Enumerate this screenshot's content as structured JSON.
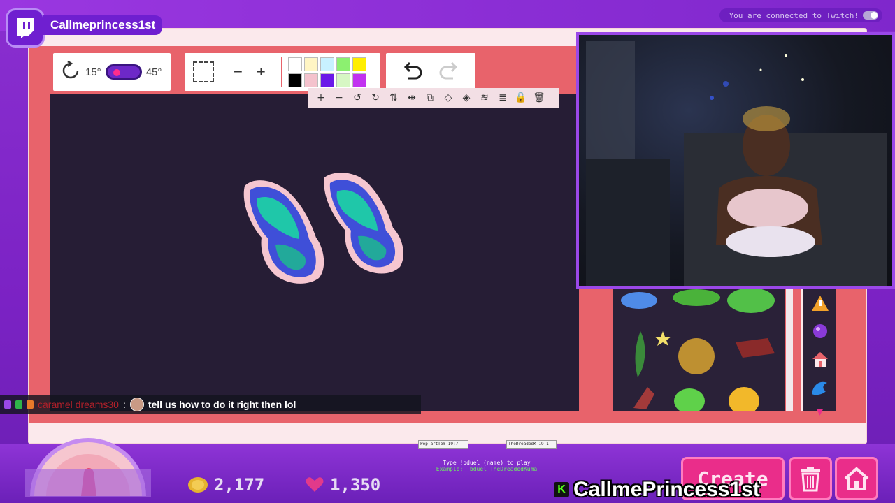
{
  "overlay": {
    "channel_name": "Callmeprincess1st",
    "connection_status": "You are connected to Twitch!"
  },
  "toolbar": {
    "rotate_min": "15°",
    "rotate_max": "45°",
    "zoom_out": "−",
    "zoom_in": "+",
    "palette": [
      "#ffffff",
      "#fff5c4",
      "#c8f1ff",
      "#8cf070",
      "#ffee00",
      "#000000",
      "#f4c2cd",
      "#6b18e8",
      "#d7f7c4",
      "#c232f0"
    ]
  },
  "layer_toolbar": {
    "buttons": [
      "+",
      "−",
      "↺",
      "↻",
      "⇅",
      "⇹",
      "⧉",
      "◇",
      "◈",
      "≋",
      "≣",
      "🔓",
      "🗑"
    ]
  },
  "stickers": {
    "categories": [
      "warning-cone-icon",
      "purple-orb-icon",
      "house-icon",
      "wave-icon"
    ],
    "scroll_down": "▾"
  },
  "chat": {
    "username": "caramel dreams30",
    "separator": ":",
    "message": "tell us how to do it right then lol"
  },
  "hud": {
    "coins": "2,177",
    "hearts": "1,350",
    "duel_card_1": "PopTartTom 19:7",
    "duel_card_2": "TheDreadedK 19:1",
    "duel_hint_1": "Type !bduel (name) to play",
    "duel_hint_2": "Example: !bduel TheDreadedKuma",
    "create_label": "Create",
    "footer_channel": "CallmePrincess1st",
    "footer_icon": "K"
  },
  "colors": {
    "app_bg": "#e8636b",
    "canvas_bg": "#261d35",
    "accent_pink": "#ea2d8a",
    "frame_purple": "#7b22c4"
  }
}
